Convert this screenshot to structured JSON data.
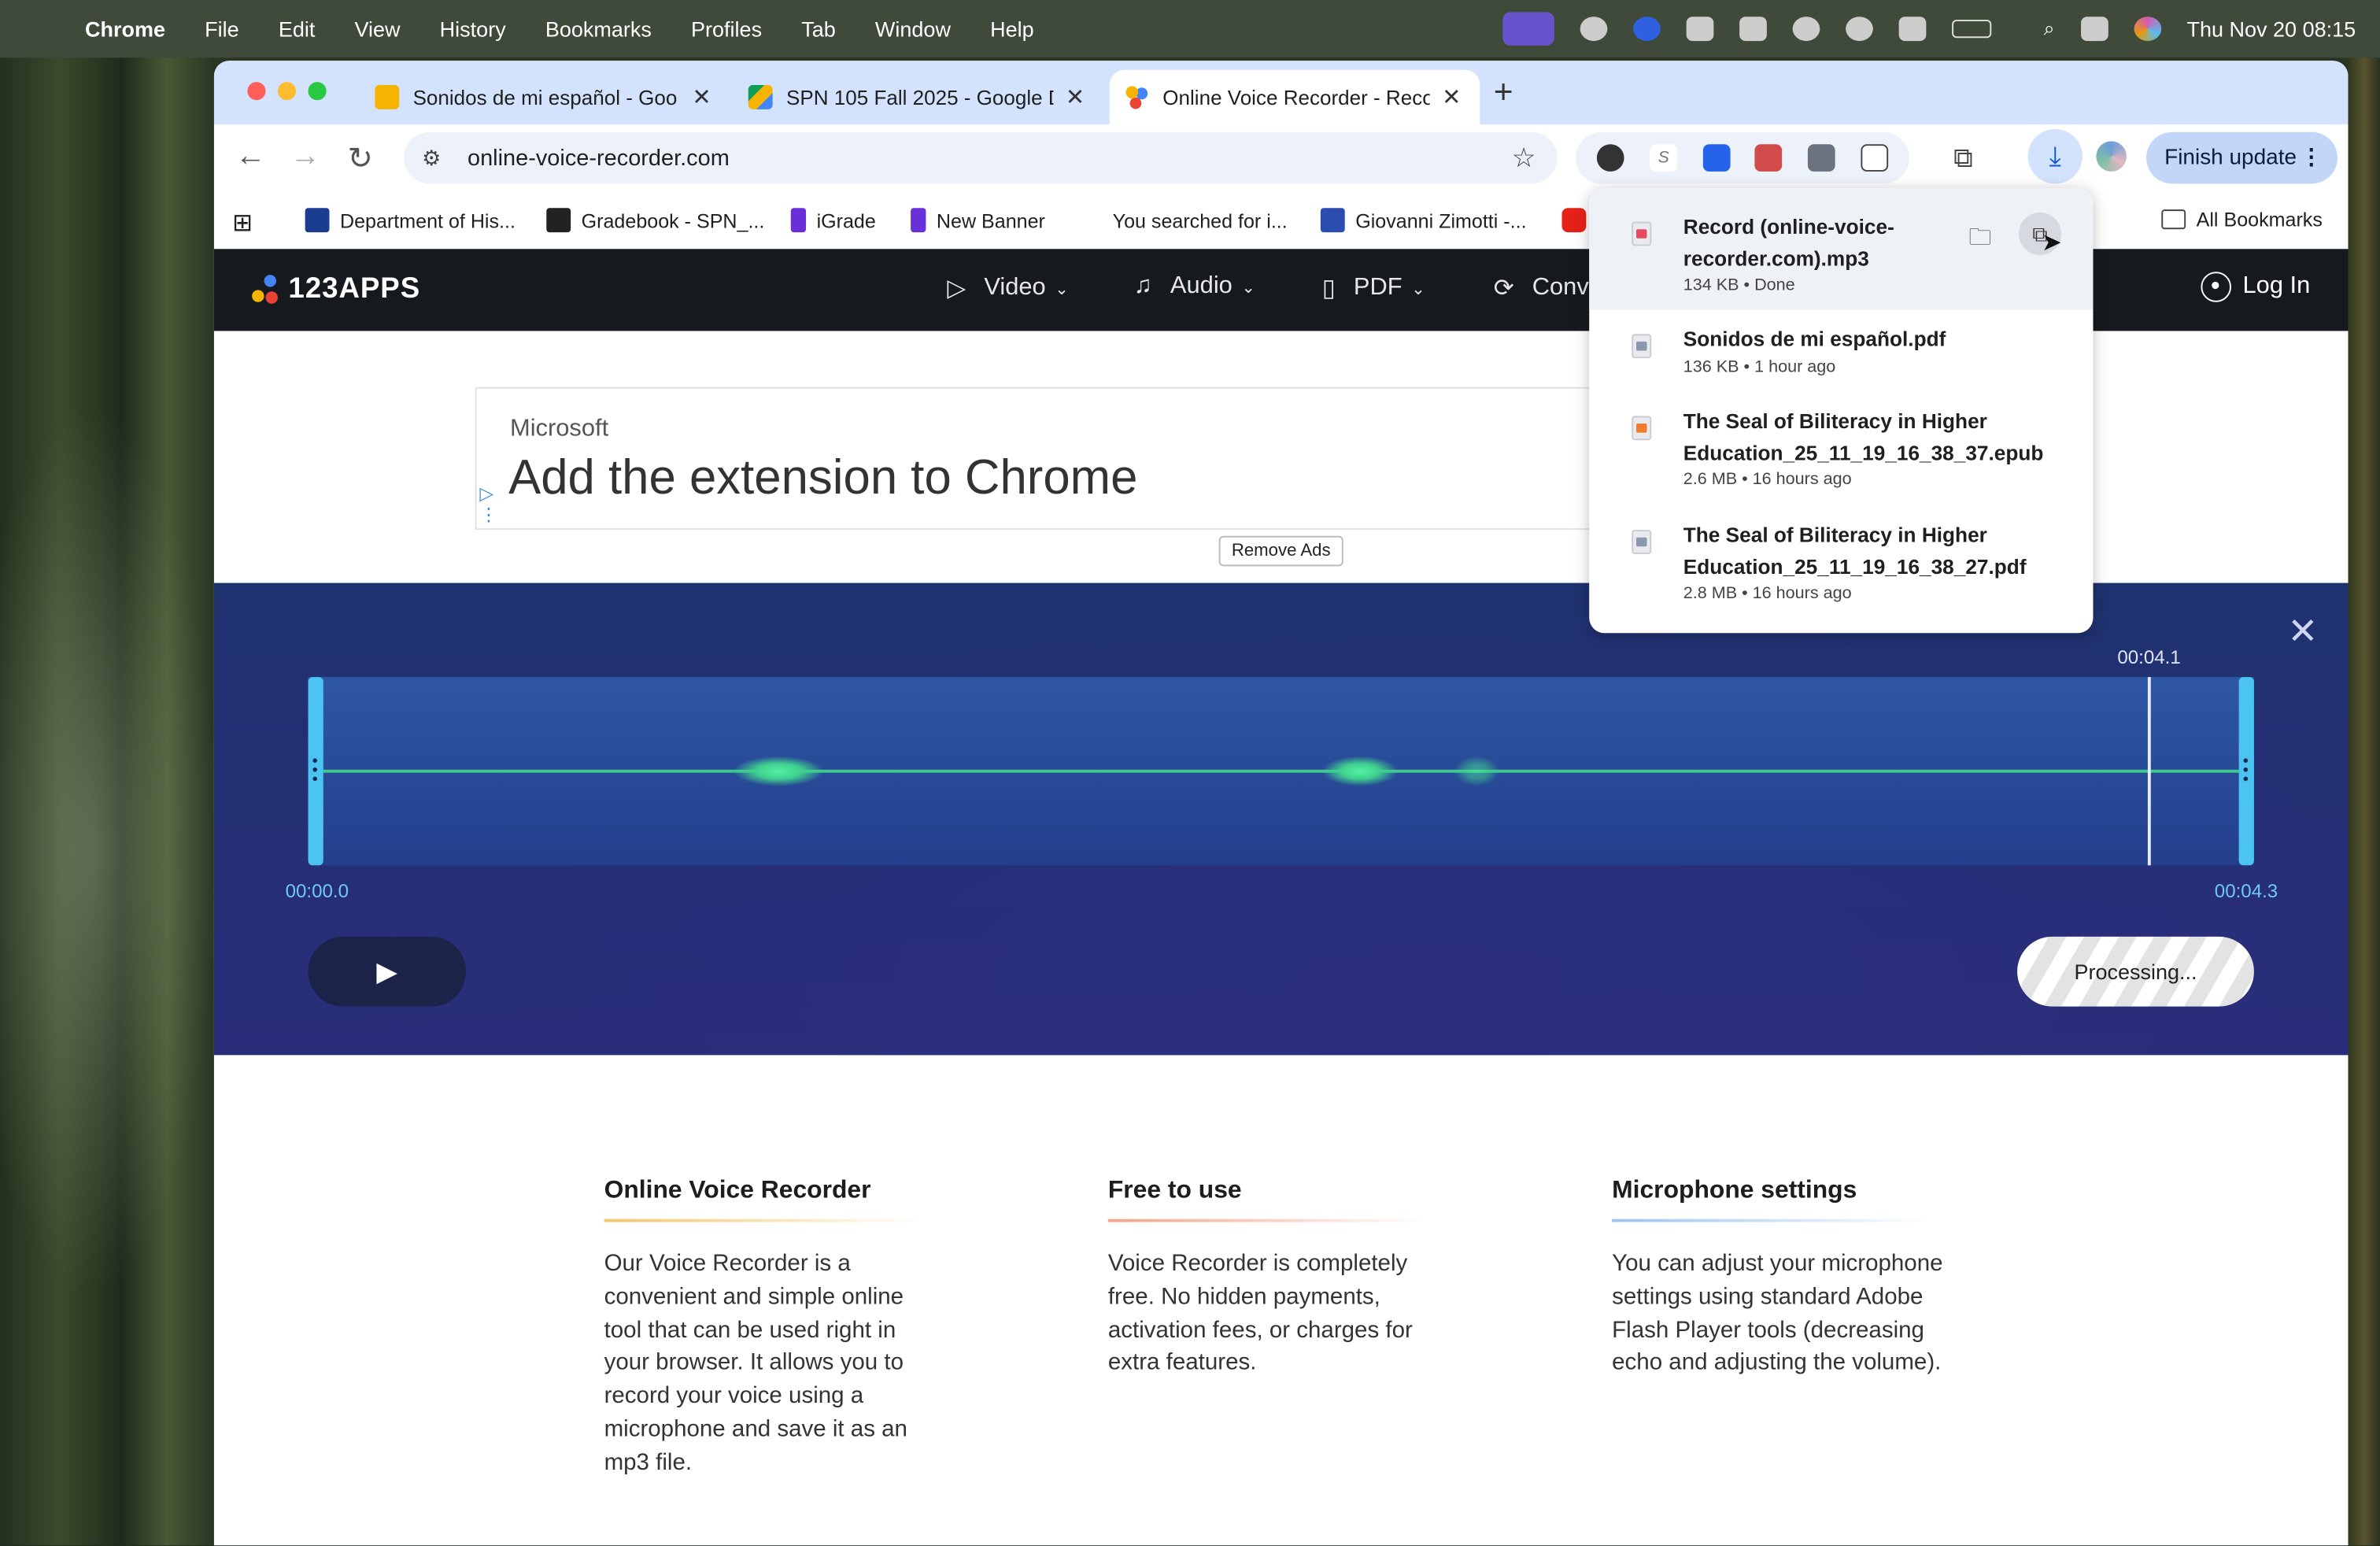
{
  "menubar": {
    "app": "Chrome",
    "items": [
      "File",
      "Edit",
      "View",
      "History",
      "Bookmarks",
      "Profiles",
      "Tab",
      "Window",
      "Help"
    ],
    "clock": "Thu Nov 20  08:15"
  },
  "tabs": [
    {
      "label": "Sonidos de mi español - Goo",
      "favicon_color": "#f4b400"
    },
    {
      "label": "SPN 105 Fall 2025 - Google D",
      "favicon_color": "#0f9d58"
    },
    {
      "label": "Online Voice Recorder - Reco",
      "favicon_color": "#4285f4"
    }
  ],
  "omnibox": {
    "url": "online-voice-recorder.com"
  },
  "toolbar": {
    "finish_update": "Finish update"
  },
  "bookmarks": [
    {
      "label": "Department of His...",
      "color": "#1a3d8f"
    },
    {
      "label": "Gradebook - SPN_...",
      "color": "#222"
    },
    {
      "label": "iGrade",
      "color": "#6a2fd9"
    },
    {
      "label": "New Banner",
      "color": "#6a2fd9"
    },
    {
      "label": "You searched for i...",
      "color": "#3b82f6"
    },
    {
      "label": "Giovanni Zimotti -...",
      "color": "#2b4db0"
    },
    {
      "label": "All Bookmarks",
      "color": "#444"
    }
  ],
  "site": {
    "logo": "123APPS",
    "nav": [
      {
        "label": "Video",
        "icon": "video-icon"
      },
      {
        "label": "Audio",
        "icon": "music-note-icon"
      },
      {
        "label": "PDF",
        "icon": "document-icon"
      },
      {
        "label": "Conv",
        "icon": "convert-icon"
      }
    ],
    "login": "Log In",
    "ad": {
      "brand": "Microsoft",
      "headline": "Add the extension to Chrome"
    },
    "remove_ads": "Remove Ads"
  },
  "recorder": {
    "cursor_time": "00:04.1",
    "start_time": "00:00.0",
    "end_time": "00:04.3",
    "processing": "Processing...",
    "play_icon": "play-icon"
  },
  "features": [
    {
      "title": "Online Voice Recorder",
      "text": "Our Voice Recorder is a convenient and simple online tool that can be used right in your browser. It allows you to record your voice using a microphone and save it as an mp3 file.",
      "accent": "#f3c56a"
    },
    {
      "title": "Free to use",
      "text": "Voice Recorder is completely free. No hidden payments, activation fees, or charges for extra features.",
      "accent": "#f2a48a"
    },
    {
      "title": "Microphone settings",
      "text": "You can adjust your microphone settings using standard Adobe Flash Player tools (decreasing echo and adjusting the volume).",
      "accent": "#9cc3f0"
    }
  ],
  "downloads": [
    {
      "name": "Record (online-voice-recorder.com).mp3",
      "status": "134 KB • Done",
      "icon_color": "#e84a5f"
    },
    {
      "name": "Sonidos de mi español.pdf",
      "status": "136 KB • 1 hour ago",
      "icon_color": "#8a97ad"
    },
    {
      "name": "The Seal of Biliteracy in Higher Education_25_11_19_16_38_37.epub",
      "status": "2.6 MB • 16 hours ago",
      "icon_color": "#f07b2a"
    },
    {
      "name": "The Seal of Biliteracy in Higher Education_25_11_19_16_38_27.pdf",
      "status": "2.8 MB • 16 hours ago",
      "icon_color": "#8a97ad"
    }
  ],
  "colors": {
    "accent": "#4cc4f2",
    "wave": "#3ec98e",
    "header": "#161a1e"
  }
}
